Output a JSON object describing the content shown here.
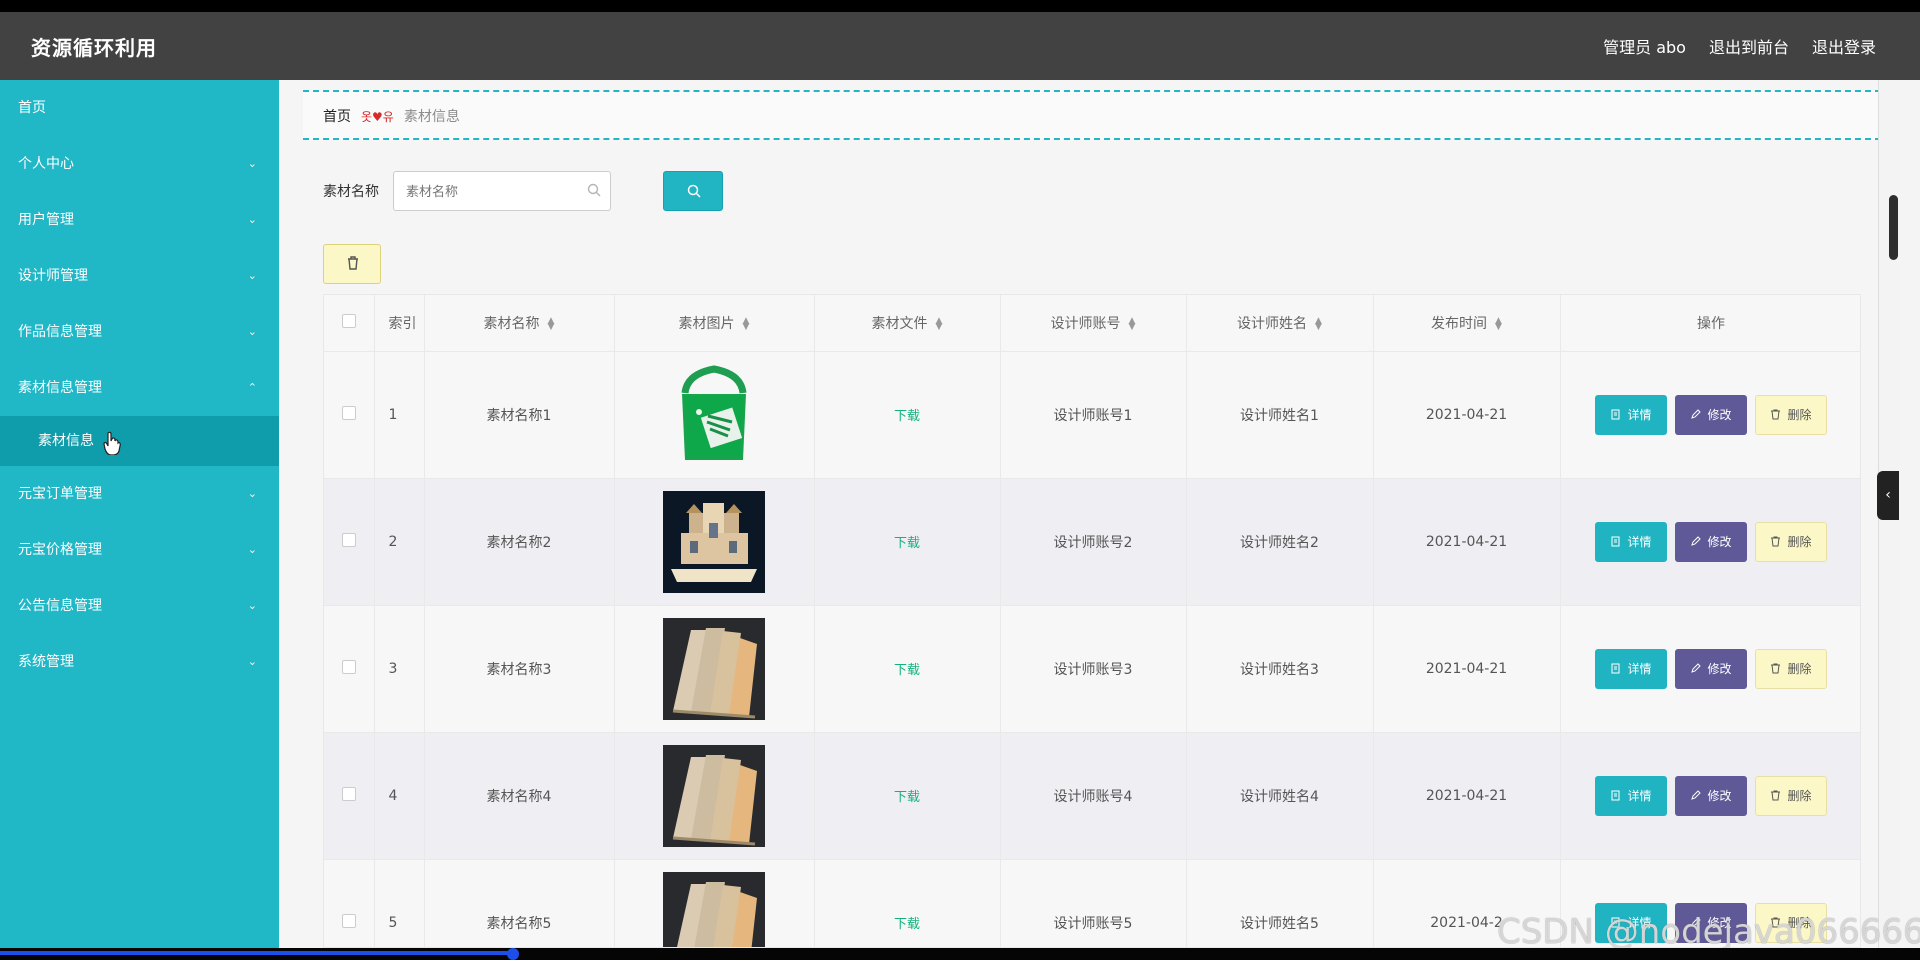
{
  "app": {
    "title": "资源循环利用",
    "user": "管理员 abo",
    "links": [
      "退出到前台",
      "退出登录"
    ]
  },
  "sidebar": {
    "items": [
      {
        "label": "首页",
        "expanded": false,
        "has_chevron": false
      },
      {
        "label": "个人中心",
        "expanded": false,
        "has_chevron": true
      },
      {
        "label": "用户管理",
        "expanded": false,
        "has_chevron": true
      },
      {
        "label": "设计师管理",
        "expanded": false,
        "has_chevron": true
      },
      {
        "label": "作品信息管理",
        "expanded": false,
        "has_chevron": true
      },
      {
        "label": "素材信息管理",
        "expanded": true,
        "has_chevron": true
      },
      {
        "label": "元宝订单管理",
        "expanded": false,
        "has_chevron": true
      },
      {
        "label": "元宝价格管理",
        "expanded": false,
        "has_chevron": true
      },
      {
        "label": "公告信息管理",
        "expanded": false,
        "has_chevron": true
      },
      {
        "label": "系统管理",
        "expanded": false,
        "has_chevron": true
      }
    ],
    "active_subitem": "素材信息"
  },
  "breadcrumb": {
    "home": "首页",
    "separator": "옷♥유",
    "current": "素材信息"
  },
  "filter": {
    "label": "素材名称",
    "placeholder": "素材名称"
  },
  "table": {
    "headers": [
      "索引",
      "素材名称",
      "素材图片",
      "素材文件",
      "设计师账号",
      "设计师姓名",
      "发布时间",
      "操作"
    ],
    "rows": [
      {
        "index": "1",
        "name": "素材名称1",
        "file": "下载",
        "account": "设计师账号1",
        "designer": "设计师姓名1",
        "date": "2021-04-21",
        "image": "green-bag"
      },
      {
        "index": "2",
        "name": "素材名称2",
        "file": "下载",
        "account": "设计师账号2",
        "designer": "设计师姓名2",
        "date": "2021-04-21",
        "image": "building-blocks"
      },
      {
        "index": "3",
        "name": "素材名称3",
        "file": "下载",
        "account": "设计师账号3",
        "designer": "设计师姓名3",
        "date": "2021-04-21",
        "image": "wood-samples"
      },
      {
        "index": "4",
        "name": "素材名称4",
        "file": "下载",
        "account": "设计师账号4",
        "designer": "设计师姓名4",
        "date": "2021-04-21",
        "image": "wood-samples"
      },
      {
        "index": "5",
        "name": "素材名称5",
        "file": "下载",
        "account": "设计师账号5",
        "designer": "设计师姓名5",
        "date": "2021-04-2",
        "image": "wood-samples"
      }
    ],
    "actions": [
      "详情",
      "修改",
      "删除"
    ]
  },
  "watermark": "CSDN @nodejava066666",
  "colors": {
    "topbar": "#424242",
    "sidebar": "#20b7c7",
    "accent": "#20b4c3",
    "edit": "#5f5997",
    "delete": "#fbf7c7",
    "download": "#13b27b"
  },
  "video_progress": 0.268
}
